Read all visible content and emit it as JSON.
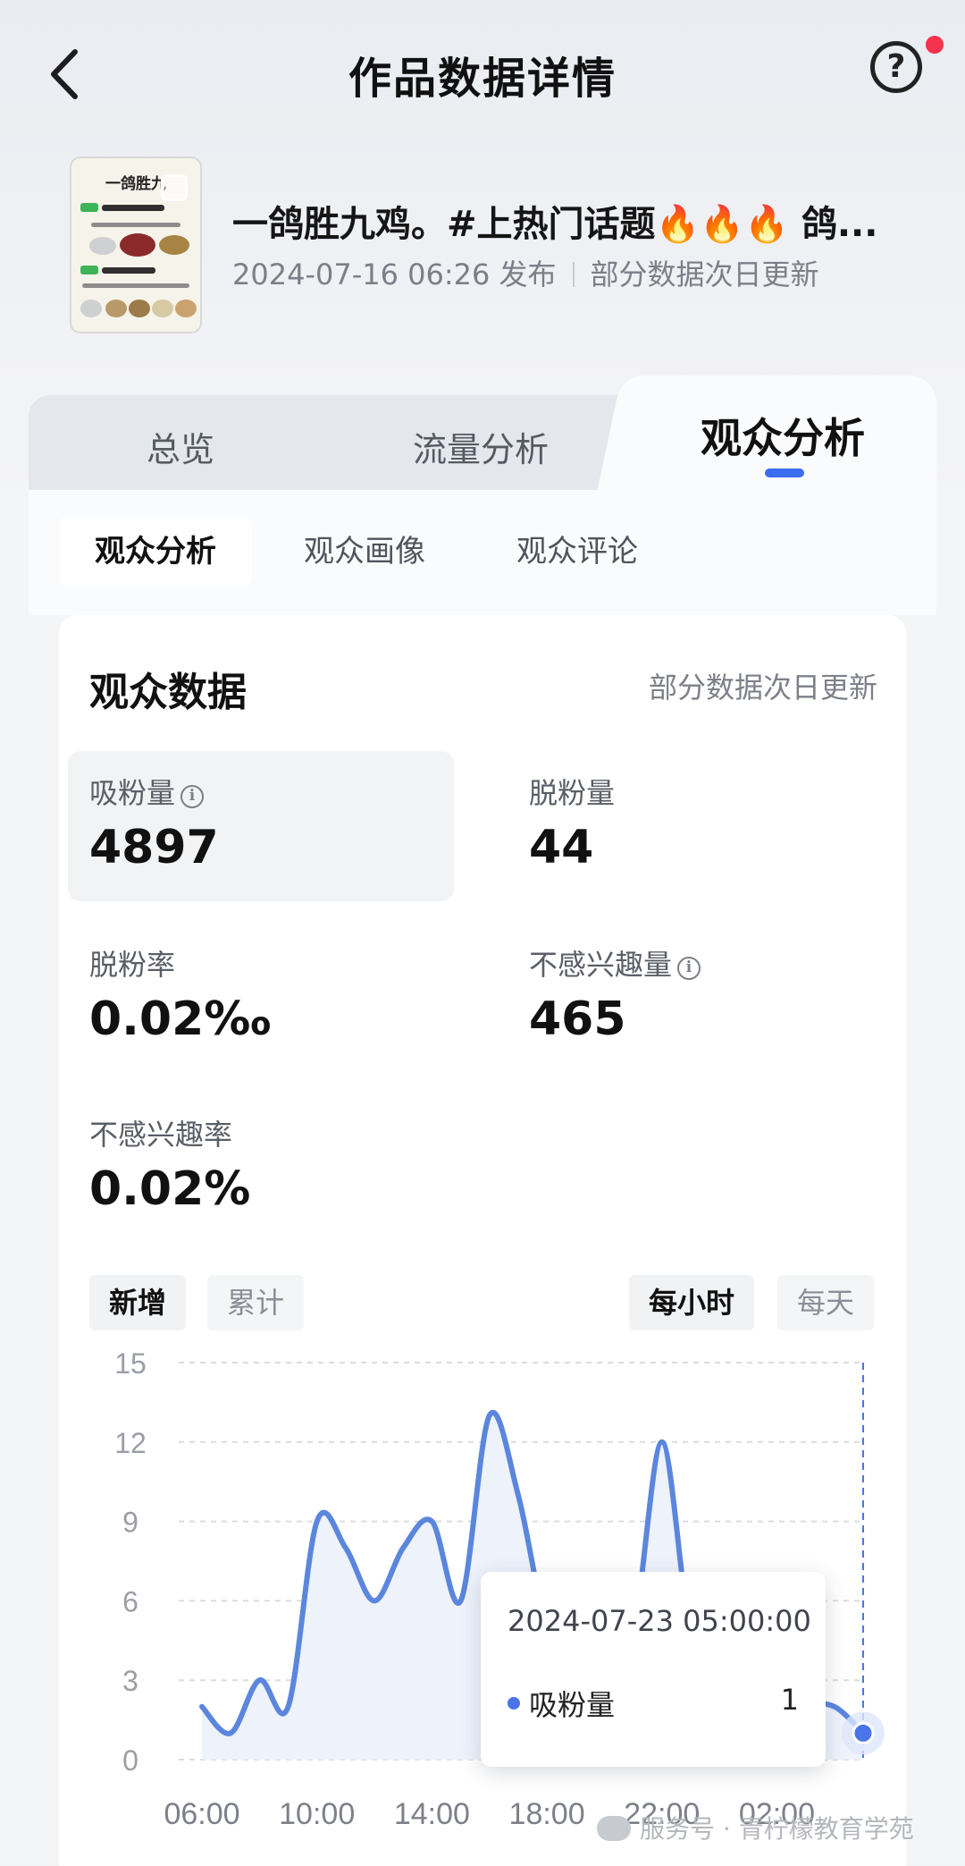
{
  "header": {
    "title": "作品数据详情",
    "help_symbol": "?"
  },
  "video": {
    "thumbnail_title": "一鸽胜九",
    "caption": "一鸽胜九鸡。#上热门话题🔥🔥🔥 鸽...",
    "published": "2024-07-16 06:26 发布",
    "update_note": "部分数据次日更新"
  },
  "tabs": [
    {
      "label": "总览"
    },
    {
      "label": "流量分析"
    },
    {
      "label": "观众分析"
    }
  ],
  "subtabs": [
    {
      "label": "观众分析"
    },
    {
      "label": "观众画像"
    },
    {
      "label": "观众评论"
    }
  ],
  "audience": {
    "title": "观众数据",
    "note": "部分数据次日更新",
    "stats": [
      {
        "label": "吸粉量",
        "value": "4897",
        "info": "i"
      },
      {
        "label": "脱粉量",
        "value": "44"
      },
      {
        "label": "脱粉率",
        "value": "0.02‰"
      },
      {
        "label": "不感兴趣量",
        "value": "465",
        "info": "i"
      },
      {
        "label": "不感兴趣率",
        "value": "0.02%"
      }
    ]
  },
  "toggles": {
    "mode_new": "新增",
    "mode_cumulative": "累计",
    "hourly": "每小时",
    "daily": "每天"
  },
  "tooltip": {
    "time": "2024-07-23 05:00:00",
    "series": "吸粉量",
    "value": "1"
  },
  "chart_data": {
    "type": "line",
    "series": [
      {
        "name": "吸粉量",
        "color": "#5b86dd"
      }
    ],
    "x": [
      "06:00",
      "07:00",
      "08:00",
      "09:00",
      "10:00",
      "11:00",
      "12:00",
      "13:00",
      "14:00",
      "15:00",
      "16:00",
      "17:00",
      "18:00",
      "19:00",
      "20:00",
      "21:00",
      "22:00",
      "23:00",
      "00:00",
      "01:00",
      "02:00",
      "03:00",
      "04:00",
      "05:00"
    ],
    "y": [
      2,
      1,
      3,
      2,
      9,
      8,
      6,
      8,
      9,
      6,
      13,
      10,
      5,
      4,
      6,
      5,
      12,
      5,
      6,
      5,
      1,
      2,
      2,
      1
    ],
    "xticks": [
      "06:00",
      "10:00",
      "14:00",
      "18:00",
      "22:00",
      "02:00"
    ],
    "yticks": [
      0,
      3,
      6,
      9,
      12,
      15
    ],
    "ylim": [
      0,
      15
    ],
    "grid": true,
    "highlight_index": 23
  },
  "watermark": "服务号 · 青柠檬教育学苑"
}
